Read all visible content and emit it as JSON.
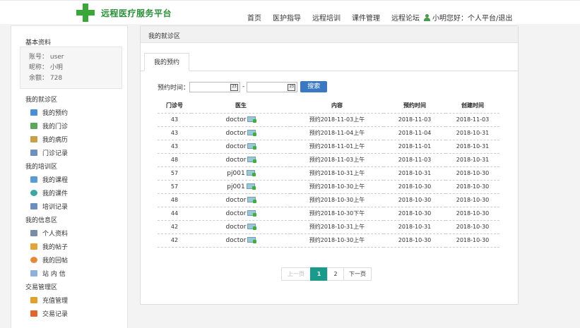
{
  "header": {
    "logo_text": "远程医疗服务平台",
    "nav": [
      "首页",
      "医护指导",
      "远程培训",
      "课件管理",
      "远程论坛"
    ],
    "user_text": "小明您好：个人平台/退出"
  },
  "sidebar": {
    "basic_title": "基本资料",
    "profile": [
      "账号： user",
      "昵称： 小明",
      "余额： 728"
    ],
    "sections": [
      {
        "title": "我的就诊区",
        "items": [
          "我的预约",
          "我的门诊",
          "我的病历",
          "门诊记录"
        ]
      },
      {
        "title": "我的培训区",
        "items": [
          "我的课程",
          "我的课件",
          "培训记录"
        ]
      },
      {
        "title": "我的信息区",
        "items": [
          "个人资料",
          "我的帖子",
          "我的回帖",
          "站 内 信"
        ]
      },
      {
        "title": "交易管理区",
        "items": [
          "充值管理",
          "交易记录"
        ]
      }
    ]
  },
  "main": {
    "title": "我的就诊区",
    "tab": "我的预约",
    "search_label": "预约时间：",
    "date_dash": "-",
    "search_button": "搜索",
    "calendar_glyph": "23",
    "columns": [
      "门诊号",
      "医生",
      "内容",
      "预约时间",
      "创建时间"
    ],
    "rows": [
      [
        "43",
        "doctor",
        "预约2018-11-03上午",
        "2018-11-03",
        "2018-11-03"
      ],
      [
        "43",
        "doctor",
        "预约2018-11-04上午",
        "2018-11-04",
        "2018-10-31"
      ],
      [
        "43",
        "doctor",
        "预约2018-11-01上午",
        "2018-11-01",
        "2018-10-31"
      ],
      [
        "48",
        "doctor",
        "预约2018-11-03上午",
        "2018-11-03",
        "2018-10-31"
      ],
      [
        "57",
        "pj001",
        "预约2018-10-31上午",
        "2018-10-31",
        "2018-10-30"
      ],
      [
        "57",
        "pj001",
        "预约2018-10-30上午",
        "2018-10-30",
        "2018-10-30"
      ],
      [
        "48",
        "doctor",
        "预约2018-10-30上午",
        "2018-10-30",
        "2018-10-30"
      ],
      [
        "44",
        "doctor",
        "预约2018-10-30下午",
        "2018-10-30",
        "2018-10-30"
      ],
      [
        "42",
        "doctor",
        "预约2018-10-31上午",
        "2018-10-31",
        "2018-10-30"
      ],
      [
        "42",
        "doctor",
        "预约2018-10-30上午",
        "2018-10-30",
        "2018-10-30"
      ]
    ],
    "pager": {
      "prev": "上一页",
      "pages": [
        "1",
        "2"
      ],
      "next": "下一页"
    }
  },
  "colors": {
    "accent_green": "#3aa63a",
    "button_blue": "#3a78c3",
    "page_active": "#1a9a8a"
  }
}
